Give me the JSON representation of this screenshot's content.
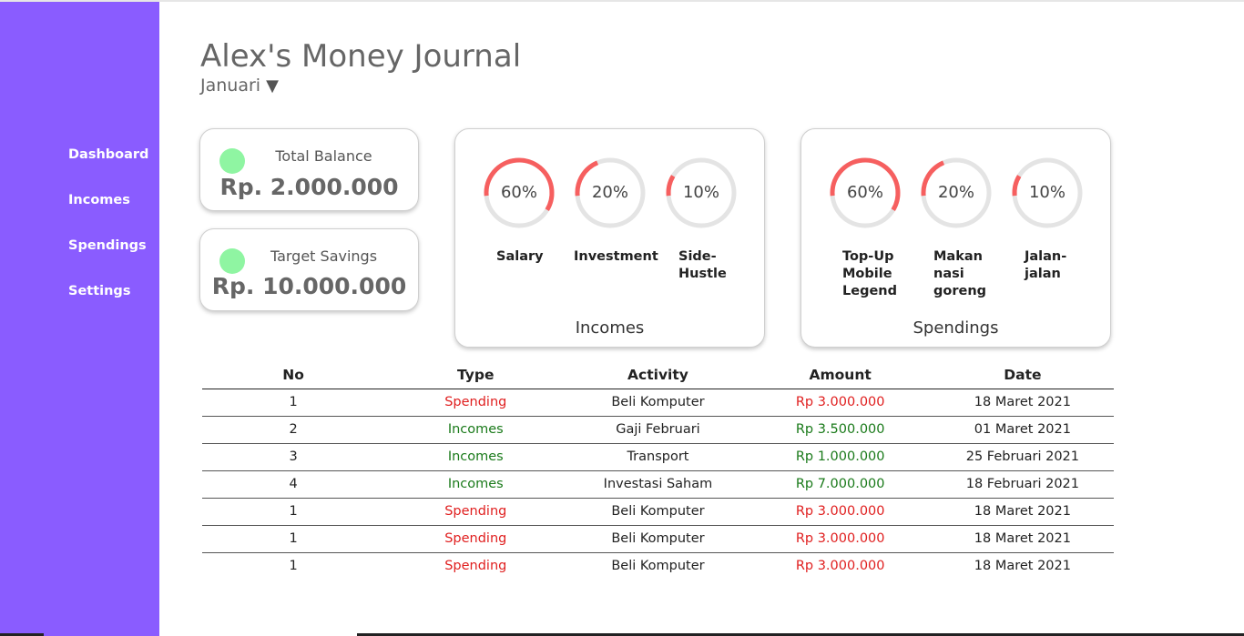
{
  "sidebar": {
    "items": [
      {
        "label": "Dashboard"
      },
      {
        "label": "Incomes"
      },
      {
        "label": "Spendings"
      },
      {
        "label": "Settings"
      }
    ]
  },
  "header": {
    "title": "Alex's Money Journal",
    "month": "Januari",
    "month_caret": "▼"
  },
  "summary": {
    "total_balance_label": "Total Balance",
    "total_balance_value": "Rp. 2.000.000",
    "target_savings_label": "Target Savings",
    "target_savings_value": "Rp. 10.000.000",
    "indicator_color": "#8ff5a2"
  },
  "incomes_chart": {
    "title": "Incomes",
    "items": [
      {
        "percent_label": "60%",
        "percent": 60,
        "name": "Salary"
      },
      {
        "percent_label": "20%",
        "percent": 20,
        "name": "Investment"
      },
      {
        "percent_label": "10%",
        "percent": 10,
        "name": "Side-\nHustle"
      }
    ]
  },
  "spendings_chart": {
    "title": "Spendings",
    "items": [
      {
        "percent_label": "60%",
        "percent": 60,
        "name": "Top-Up\nMobile\nLegend"
      },
      {
        "percent_label": "20%",
        "percent": 20,
        "name": "Makan\nnasi\ngoreng"
      },
      {
        "percent_label": "10%",
        "percent": 10,
        "name": "Jalan-\njalan"
      }
    ]
  },
  "colors": {
    "sidebar": "#8a5cff",
    "ring_fill": "#f65f5f",
    "ring_track": "#e4e4e4",
    "spending": "#e02020",
    "income": "#1a7a1a"
  },
  "transactions": {
    "headers": [
      "No",
      "Type",
      "Activity",
      "Amount",
      "Date"
    ],
    "rows": [
      {
        "no": "1",
        "type": "Spending",
        "activity": "Beli Komputer",
        "amount": "Rp 3.000.000",
        "date": "18 Maret 2021"
      },
      {
        "no": "2",
        "type": "Incomes",
        "activity": "Gaji Februari",
        "amount": "Rp 3.500.000",
        "date": "01 Maret 2021"
      },
      {
        "no": "3",
        "type": "Incomes",
        "activity": "Transport",
        "amount": "Rp 1.000.000",
        "date": "25 Februari 2021"
      },
      {
        "no": "4",
        "type": "Incomes",
        "activity": "Investasi Saham",
        "amount": "Rp 7.000.000",
        "date": "18 Februari 2021"
      },
      {
        "no": "1",
        "type": "Spending",
        "activity": "Beli Komputer",
        "amount": "Rp 3.000.000",
        "date": "18 Maret 2021"
      },
      {
        "no": "1",
        "type": "Spending",
        "activity": "Beli Komputer",
        "amount": "Rp 3.000.000",
        "date": "18 Maret 2021"
      },
      {
        "no": "1",
        "type": "Spending",
        "activity": "Beli Komputer",
        "amount": "Rp 3.000.000",
        "date": "18 Maret 2021"
      }
    ]
  }
}
